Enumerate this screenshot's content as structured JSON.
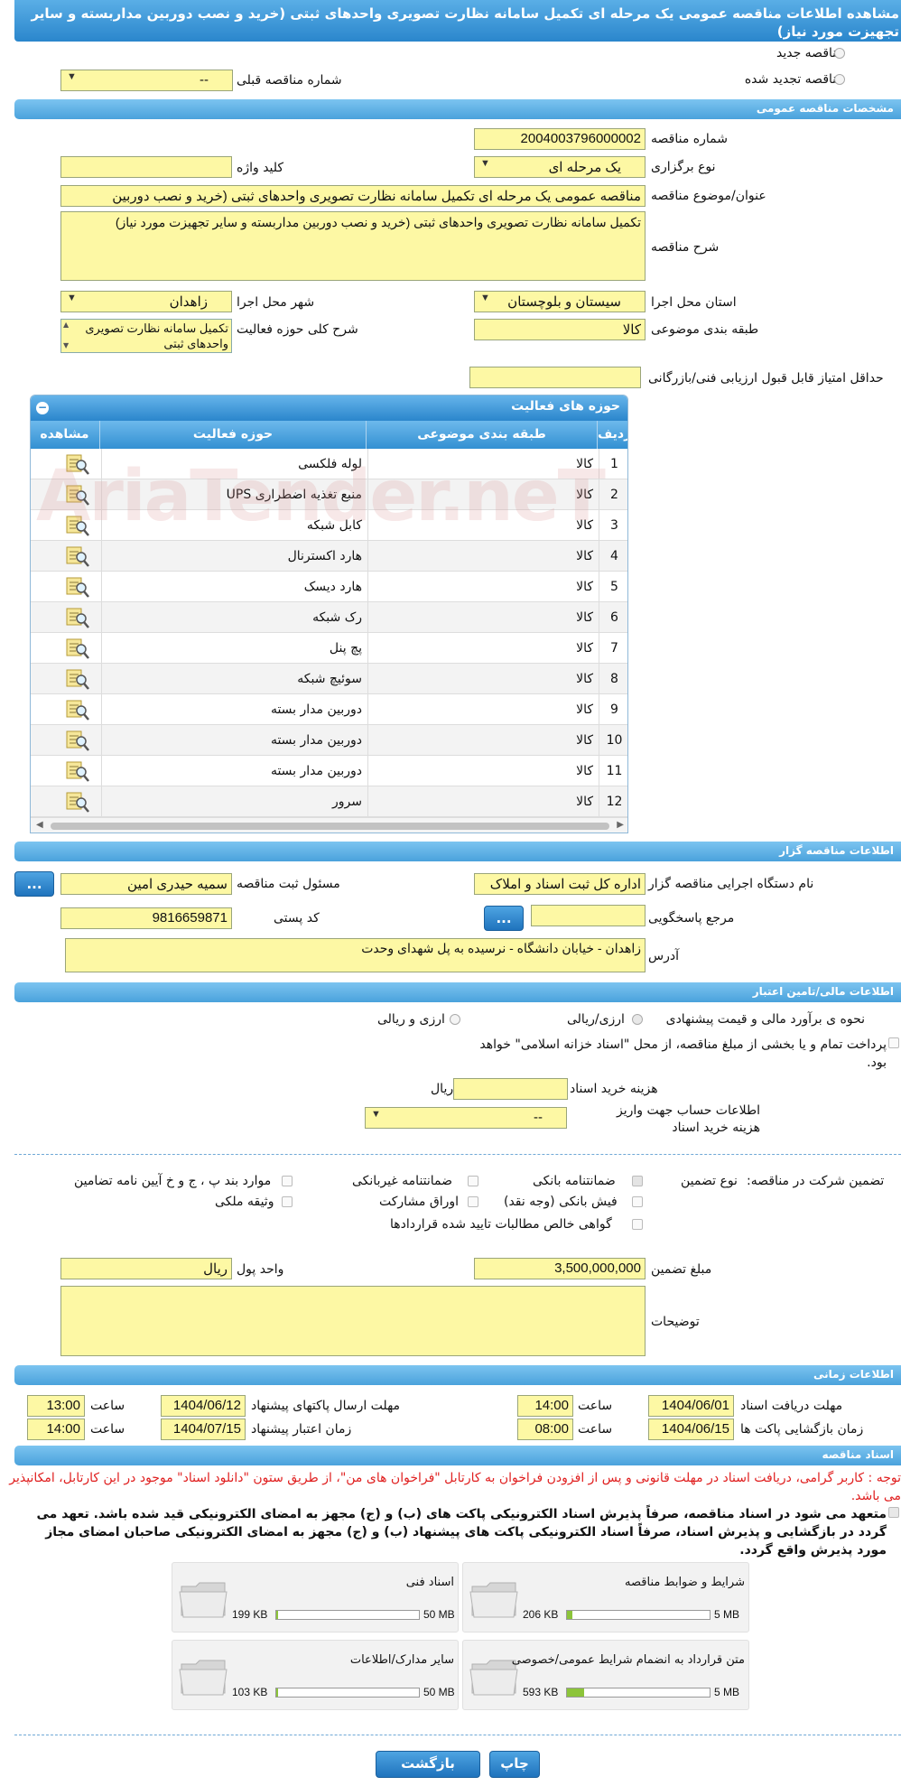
{
  "page_title": "مشاهده اطلاعات مناقصه عمومی یک مرحله ای تکمیل سامانه نظارت تصویری واحدهای ثبتی (خرید و نصب دوربین مداربسته و سایر تجهیزت مورد نیاز)",
  "header": {
    "new_tender_label": "مناقصه جدید",
    "renewed_tender_label": "مناقصه تجدید شده",
    "previous_tender_label": "شماره مناقصه قبلی",
    "previous_tender_value": "--"
  },
  "general": {
    "section_title": "مشخصات مناقصه عمومی",
    "tender_number_label": "شماره مناقصه",
    "tender_number": "2004003796000002",
    "holding_type_label": "نوع برگزاری",
    "holding_type": "یک مرحله ای",
    "keyword_label": "کلید واژه",
    "keyword": "",
    "subject_label": "عنوان/موضوع مناقصه",
    "subject": "مناقصه عمومی یک مرحله ای تکمیل سامانه نظارت تصویری واحدهای ثبتی (خرید و نصب دوربین",
    "description_label": "شرح مناقصه",
    "description": "تکمیل سامانه نظارت تصویری واحدهای ثبتی (خرید و نصب دوربین مداربسته و سایر تجهیزت مورد نیاز)",
    "province_label": "استان محل اجرا",
    "province": "سیستان و بلوچستان",
    "city_label": "شهر محل اجرا",
    "city": "زاهدان",
    "category_label": "طبقه بندی موضوعی",
    "category": "کالا",
    "activity_desc_label": "شرح کلی حوزه فعالیت",
    "activity_desc": "تکمیل سامانه نظارت تصویری واحدهای ثبتی",
    "min_score_label": "حداقل امتیاز قابل قبول ارزیابی فنی/بازرگانی",
    "min_score": ""
  },
  "activities": {
    "title": "حوزه های فعالیت",
    "col_row": "ردیف",
    "col_category": "طبقه بندی موضوعی",
    "col_field": "حوزه فعالیت",
    "col_view": "مشاهده",
    "rows": [
      {
        "n": "1",
        "cat": "کالا",
        "field": "لوله فلکسی"
      },
      {
        "n": "2",
        "cat": "کالا",
        "field": "منبع تغذیه اضطراری UPS"
      },
      {
        "n": "3",
        "cat": "کالا",
        "field": "کابل شبکه"
      },
      {
        "n": "4",
        "cat": "کالا",
        "field": "هارد اکسترنال"
      },
      {
        "n": "5",
        "cat": "کالا",
        "field": "هارد دیسک"
      },
      {
        "n": "6",
        "cat": "کالا",
        "field": "رک شبکه"
      },
      {
        "n": "7",
        "cat": "کالا",
        "field": "پچ پنل"
      },
      {
        "n": "8",
        "cat": "کالا",
        "field": "سوئیچ شبکه"
      },
      {
        "n": "9",
        "cat": "کالا",
        "field": "دوربین مدار بسته"
      },
      {
        "n": "10",
        "cat": "کالا",
        "field": "دوربین مدار بسته"
      },
      {
        "n": "11",
        "cat": "کالا",
        "field": "دوربین مدار بسته"
      },
      {
        "n": "12",
        "cat": "کالا",
        "field": "سرور"
      }
    ]
  },
  "watermark": "AriaTender.neT",
  "organizer": {
    "section_title": "اطلاعات مناقصه گزار",
    "agency_label": "نام دستگاه اجرایی مناقصه گزار",
    "agency": "اداره کل ثبت اسناد و املاک",
    "registrar_label": "مسئول ثبت مناقصه",
    "registrar": "سمیه حیدری امین",
    "reference_label": "مرجع پاسخگویی",
    "reference": "",
    "postal_label": "کد پستی",
    "postal": "9816659871",
    "address_label": "آدرس",
    "address": "زاهدان - خیابان دانشگاه - نرسیده به پل شهدای وحدت",
    "dots_button": "..."
  },
  "financial": {
    "section_title": "اطلاعات مالی/تامین اعتبار",
    "estimate_label": "نحوه ی برآورد مالی و قیمت پیشنهادی",
    "opt_rial": "ارزی/ریالی",
    "opt_currency_rial": "ارزی و ریالی",
    "treasury_text": "پرداخت تمام و یا بخشی از مبلغ مناقصه، از محل \"اسناد خزانه اسلامی\" خواهد بود.",
    "doc_cost_label": "هزینه خرید اسناد",
    "doc_cost": "",
    "rial": "ریال",
    "account_label": "اطلاعات حساب جهت واریز هزینه خرید اسناد",
    "account_value": "--",
    "guarantee_label": "تضمین شرکت در مناقصه:",
    "guarantee_type_label": "نوع تضمین",
    "g_bank": "ضمانتنامه بانکی",
    "g_nonbank": "ضمانتنامه غیربانکی",
    "g_clauses": "موارد بند پ ، ج و خ آیین نامه تضامین",
    "g_cheque": "فیش بانکی (وجه نقد)",
    "g_bonds": "اوراق مشارکت",
    "g_property": "وثیقه ملکی",
    "g_claims": "گواهی خالص مطالبات تایید شده قراردادها",
    "amount_label": "مبلغ تضمین",
    "amount": "3,500,000,000",
    "currency_label": "واحد پول",
    "currency": "ریال",
    "notes_label": "توضیحات",
    "notes": ""
  },
  "timing": {
    "section_title": "اطلاعات زمانی",
    "receive_label": "مهلت دریافت اسناد",
    "receive_date": "1404/06/01",
    "receive_time": "14:00",
    "send_label": "مهلت ارسال پاکتهای پیشنهاد",
    "send_date": "1404/06/12",
    "send_time": "13:00",
    "open_label": "زمان بازگشایی پاکت ها",
    "open_date": "1404/06/15",
    "open_time": "08:00",
    "valid_label": "زمان اعتبار پیشنهاد",
    "valid_date": "1404/07/15",
    "valid_time": "14:00",
    "time_label": "ساعت"
  },
  "documents": {
    "section_title": "اسناد مناقصه",
    "notice": "توجه : کاربر گرامی، دریافت اسناد در مهلت قانونی و پس از افزودن فراخوان به کارتابل \"فراخوان های من\"، از طریق ستون \"دانلود اسناد\" موجود در این کارتابل، امکانپذیر می باشد.",
    "commitment": "متعهد می شود در اسناد مناقصه، صرفاً پذیرش اسناد الکترونیکی پاکت های (ب) و (ج) مجهز به امضای الکترونیکی قید شده باشد. تعهد می گردد در بازگشایی و پذیرش اسناد، صرفاً اسناد الکترونیکی پاکت های پیشنهاد (ب) و (ج) مجهز به امضای الکترونیکی صاحبان امضای مجاز مورد پذیرش واقع گردد.",
    "files": [
      {
        "name": "شرایط و ضوابط مناقصه",
        "max": "5 MB",
        "size": "206 KB",
        "fill": 0.04
      },
      {
        "name": "اسناد فنی",
        "max": "50 MB",
        "size": "199 KB",
        "fill": 0.01
      },
      {
        "name": "متن قرارداد به انضمام شرایط عمومی/خصوصی",
        "max": "5 MB",
        "size": "593 KB",
        "fill": 0.12
      },
      {
        "name": "سایر مدارک/اطلاعات",
        "max": "50 MB",
        "size": "103 KB",
        "fill": 0.01
      }
    ]
  },
  "footer": {
    "back_button": "بازگشت",
    "print_button": "چاپ"
  }
}
